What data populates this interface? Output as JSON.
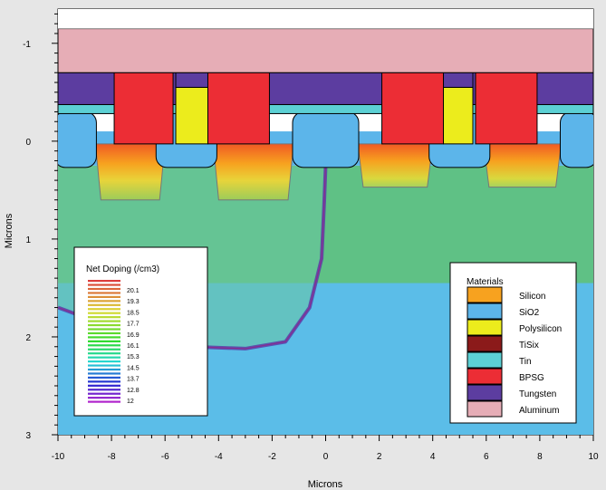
{
  "chart_data": {
    "type": "heatmap",
    "title": "",
    "xlabel": "Microns",
    "ylabel": "Microns",
    "xlim": [
      -10,
      10
    ],
    "ylim": [
      3,
      -1.35
    ],
    "y_inverted": true,
    "x_ticks": [
      -10,
      -8,
      -6,
      -4,
      -2,
      0,
      2,
      4,
      6,
      8,
      10
    ],
    "y_ticks": [
      -1,
      0,
      1,
      2,
      3
    ],
    "structure": {
      "aluminum_top": -1.15,
      "aluminum_bottom": -0.7,
      "tungsten_bottom": -0.45,
      "silicon_surface": 0.25,
      "wells": [
        {
          "x0": -8.6,
          "x1": -6.0,
          "depth": 0.35
        },
        {
          "x0": -4.2,
          "x1": -1.2,
          "depth": 0.35
        },
        {
          "x0": 1.2,
          "x1": 4.0,
          "depth": 0.22
        },
        {
          "x0": 5.9,
          "x1": 8.8,
          "depth": 0.22
        }
      ],
      "gates": [
        {
          "x0": -5.6,
          "x1": -4.4
        },
        {
          "x0": 4.4,
          "x1": 5.5
        }
      ],
      "bpsg_blocks": [
        {
          "x0": -7.9,
          "x1": -5.7
        },
        {
          "x0": -4.4,
          "x1": -2.1
        },
        {
          "x0": 2.1,
          "x1": 4.4
        },
        {
          "x0": 5.6,
          "x1": 7.9
        }
      ],
      "junction_path": [
        [
          -10,
          1.7
        ],
        [
          -9.0,
          1.8
        ],
        [
          -7.0,
          2.05
        ],
        [
          -5.0,
          2.1
        ],
        [
          -3.0,
          2.12
        ],
        [
          -1.5,
          2.05
        ],
        [
          -0.6,
          1.7
        ],
        [
          -0.15,
          1.2
        ],
        [
          -0.05,
          0.6
        ],
        [
          0,
          0.25
        ]
      ]
    }
  },
  "doping_legend": {
    "title": "Net Doping (/cm3)",
    "labels": [
      "20.1",
      "19.3",
      "18.5",
      "17.7",
      "16.9",
      "16.1",
      "15.3",
      "14.5",
      "13.7",
      "12.8",
      "12"
    ]
  },
  "materials_legend": {
    "title": "Materials",
    "items": [
      {
        "name": "Silicon",
        "color": "#f7a21f"
      },
      {
        "name": "SiO2",
        "color": "#5cb5ea"
      },
      {
        "name": "Polysilicon",
        "color": "#ecec1c"
      },
      {
        "name": "TiSix",
        "color": "#8b1a1a"
      },
      {
        "name": "Tin",
        "color": "#5cd0d4"
      },
      {
        "name": "BPSG",
        "color": "#ec2d35"
      },
      {
        "name": "Tungsten",
        "color": "#5c3da0"
      },
      {
        "name": "Aluminum",
        "color": "#e6adb6"
      }
    ]
  },
  "colors": {
    "oxide": "#5cb5ea",
    "tin": "#5cd0d4",
    "tungsten": "#5c3da0",
    "bpsg": "#ec2d35",
    "polysilicon": "#ecec1c",
    "aluminum": "#e6adb6",
    "substrate_green": "#5fc17a",
    "substrate_blue": "#5bbde8",
    "junction": "#5a3ea8"
  }
}
